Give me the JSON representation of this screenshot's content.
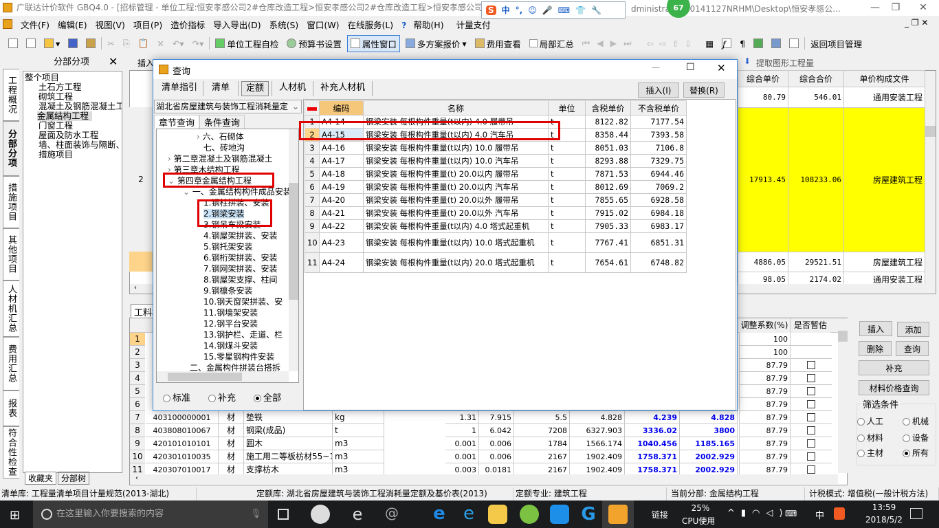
{
  "window": {
    "title": "广联达计价软件 GBQ4.0 - [招标管理 - 单位工程:恒安孝感公司2#仓库改造工程>恒安孝感公司2#仓库改造工程>恒安孝感公司2#",
    "title_tail": "dministrator\\20141127NRHM\\Desktop\\恒安孝感公...",
    "badge": "67"
  },
  "ime": {
    "items": [
      "中",
      "°,"
    ]
  },
  "menu": [
    "文件(F)",
    "编辑(E)",
    "视图(V)",
    "项目(P)",
    "造价指标",
    "导入导出(D)",
    "系统(S)",
    "窗口(W)",
    "在线服务(L)",
    "帮助(H)",
    "计量支付"
  ],
  "toolbar": {
    "self_check": "单位工程自检",
    "budget_settings": "预算书设置",
    "property_window": "属性窗口",
    "multi_quote": "多方案报价",
    "fee_view": "费用查看",
    "partial_summary": "局部汇总",
    "return": "返回项目管理",
    "extract": "提取图形工程量",
    "insert": "插入"
  },
  "vtabs": [
    "工程概况",
    "分部分项",
    "措施项目",
    "其他项目",
    "人材机汇总",
    "费用汇总",
    "报表",
    "符合性检查"
  ],
  "left_panel": {
    "title": "分部分项",
    "tree": [
      "整个项目",
      "土石方工程",
      "砌筑工程",
      "混凝土及钢筋混凝土工程",
      "金属结构工程",
      "门窗工程",
      "屋面及防水工程",
      "墙、柱面装饰与隔断、幕墙工程",
      "措施项目"
    ],
    "tabs": [
      "收藏夹",
      "分部树"
    ]
  },
  "upper_grid": {
    "headers": [
      "综合单价",
      "综合合价",
      "单价构成文件"
    ],
    "row_label": "2",
    "rows": [
      [
        "80.79",
        "546.01",
        "通用安装工程"
      ],
      [
        "17913.45",
        "108233.06",
        "房屋建筑工程"
      ],
      [
        "4886.05",
        "29521.51",
        "房屋建筑工程"
      ],
      [
        "98.05",
        "2174.02",
        "通用安装工程"
      ]
    ]
  },
  "dialog": {
    "title": "查询",
    "tabs": [
      "清单指引",
      "清单",
      "定额",
      "人材机",
      "补充人材机"
    ],
    "active_tab": "定额",
    "library": "湖北省房屋建筑与装饰工程消耗量定",
    "subtabs": [
      "章节查询",
      "条件查询"
    ],
    "tree": [
      {
        "t": "六、石砌体",
        "l": 3,
        "c": ">"
      },
      {
        "t": "七、砖地沟",
        "l": 3,
        "c": ""
      },
      {
        "t": "第二章混凝土及钢筋混凝土",
        "l": 1,
        "c": ">"
      },
      {
        "t": "第三章木结构工程",
        "l": 1,
        "c": ">"
      },
      {
        "t": "第四章金属结构工程",
        "l": 1,
        "c": "v"
      },
      {
        "t": "一、金属结构构件成品安装",
        "l": 2,
        "c": "v"
      },
      {
        "t": "1.钢柱拼装、安装",
        "l": 3,
        "c": ""
      },
      {
        "t": "2.钢梁安装",
        "l": 3,
        "c": "",
        "sel": true
      },
      {
        "t": "3.钢吊车梁安装",
        "l": 3,
        "c": ""
      },
      {
        "t": "4.钢屋架拼装、安装",
        "l": 3,
        "c": ""
      },
      {
        "t": "5.钢托架安装",
        "l": 3,
        "c": ""
      },
      {
        "t": "6.钢桁架拼装、安装",
        "l": 3,
        "c": ""
      },
      {
        "t": "7.钢网架拼装、安装",
        "l": 3,
        "c": ""
      },
      {
        "t": "8.钢屋架支撑、柱间",
        "l": 3,
        "c": ""
      },
      {
        "t": "9.钢檩条安装",
        "l": 3,
        "c": ""
      },
      {
        "t": "10.钢天窗架拼装、安",
        "l": 3,
        "c": ""
      },
      {
        "t": "11.钢墙架安装",
        "l": 3,
        "c": ""
      },
      {
        "t": "12.钢平台安装",
        "l": 3,
        "c": ""
      },
      {
        "t": "13.钢护栏、走道、栏",
        "l": 3,
        "c": ""
      },
      {
        "t": "14.钢煤斗安装",
        "l": 3,
        "c": ""
      },
      {
        "t": "15.零星钢构件安装",
        "l": 3,
        "c": ""
      },
      {
        "t": "二、金属构件拼装台搭拆",
        "l": 2,
        "c": ""
      }
    ],
    "radios": [
      {
        "label": "标准",
        "on": false
      },
      {
        "label": "补充",
        "on": false
      },
      {
        "label": "全部",
        "on": true
      }
    ],
    "buttons": {
      "insert": "插入(I)",
      "replace": "替换(R)"
    },
    "headers": [
      "编码",
      "名称",
      "单位",
      "含税单价",
      "不含税单价"
    ],
    "rows": [
      [
        "1",
        "A4-14",
        "钢梁安装 每根构件重量(t以内) 4.0 履带吊",
        "t",
        "8122.82",
        "7177.54"
      ],
      [
        "2",
        "A4-15",
        "钢梁安装 每根构件重量(t以内) 4.0 汽车吊",
        "t",
        "8358.44",
        "7393.58"
      ],
      [
        "3",
        "A4-16",
        "钢梁安装 每根构件重量(t以内) 10.0 履带吊",
        "t",
        "8051.03",
        "7106.8"
      ],
      [
        "4",
        "A4-17",
        "钢梁安装 每根构件重量(t以内) 10.0 汽车吊",
        "t",
        "8293.88",
        "7329.75"
      ],
      [
        "5",
        "A4-18",
        "钢梁安装 每根构件重量(t) 20.0以内 履带吊",
        "t",
        "7871.53",
        "6944.46"
      ],
      [
        "6",
        "A4-19",
        "钢梁安装 每根构件重量(t) 20.0以内 汽车吊",
        "t",
        "8012.69",
        "7069.2"
      ],
      [
        "7",
        "A4-20",
        "钢梁安装 每根构件重量(t) 20.0以外 履带吊",
        "t",
        "7855.65",
        "6928.58"
      ],
      [
        "8",
        "A4-21",
        "钢梁安装 每根构件重量(t) 20.0以外 汽车吊",
        "t",
        "7915.02",
        "6984.18"
      ],
      [
        "9",
        "A4-22",
        "钢梁安装 每根构件重量(t以内) 4.0 塔式起重机",
        "t",
        "7905.33",
        "6983.17"
      ],
      [
        "10",
        "A4-23",
        "钢梁安装 每根构件重量(t以内) 10.0 塔式起重机",
        "t",
        "7767.41",
        "6851.31"
      ],
      [
        "11",
        "A4-24",
        "钢梁安装 每根构件重量(t以内) 20.0 塔式起重机",
        "t",
        "7654.61",
        "6748.82"
      ]
    ]
  },
  "lower": {
    "tab": "工料机",
    "headers": {
      "adjust": "调整系数(%)",
      "estimate": "是否暂估"
    },
    "adjust": [
      "100",
      "100",
      "87.79",
      "87.79",
      "87.79",
      "87.79",
      "87.79",
      "87.79",
      "87.79",
      "87.79",
      "87.79"
    ],
    "checkbox": [
      false,
      false,
      true,
      true,
      true,
      true,
      true,
      true,
      true,
      true,
      true
    ],
    "rows": [
      [
        "7",
        "403100000001",
        "材",
        "垫铁",
        "kg",
        "1.31",
        "7.915",
        "5.5",
        "4.828",
        "4.239",
        "4.828"
      ],
      [
        "8",
        "403808010067",
        "材",
        "钢梁(成品)",
        "t",
        "1",
        "6.042",
        "7208",
        "6327.903",
        "3336.02",
        "3800"
      ],
      [
        "9",
        "420101010101",
        "材",
        "圆木",
        "m3",
        "0.001",
        "0.006",
        "1784",
        "1566.174",
        "1040.456",
        "1185.165"
      ],
      [
        "10",
        "420301010035",
        "材",
        "施工用二等板枋材55~1",
        "m3",
        "0.001",
        "0.006",
        "2167",
        "1902.409",
        "1758.371",
        "2002.929"
      ],
      [
        "11",
        "420307010017",
        "材",
        "支撑枋木",
        "m3",
        "0.003",
        "0.0181",
        "2167",
        "1902.409",
        "1758.371",
        "2002.929"
      ]
    ],
    "buttons": [
      "插入",
      "添加",
      "删除",
      "查询",
      "补充",
      "材料价格查询"
    ],
    "filter": {
      "title": "筛选条件",
      "options": [
        {
          "label": "人工",
          "on": false
        },
        {
          "label": "机械",
          "on": false
        },
        {
          "label": "材料",
          "on": false
        },
        {
          "label": "设备",
          "on": false
        },
        {
          "label": "主材",
          "on": false
        },
        {
          "label": "所有",
          "on": true
        }
      ]
    }
  },
  "status": [
    "清单库: 工程量清单项目计量规范(2013-湖北)",
    "定额库: 湖北省房屋建筑与装饰工程消耗量定额及基价表(2013)",
    "定额专业: 建筑工程",
    "当前分部: 金属结构工程",
    "计税模式: 增值税(一般计税方法)"
  ],
  "taskbar": {
    "search_placeholder": "在这里输入你要搜索的内容",
    "link": "链接",
    "cpu": "25%",
    "cpu_label": "CPU使用",
    "ime": "中",
    "time": "13:59",
    "date": "2018/5/2"
  }
}
